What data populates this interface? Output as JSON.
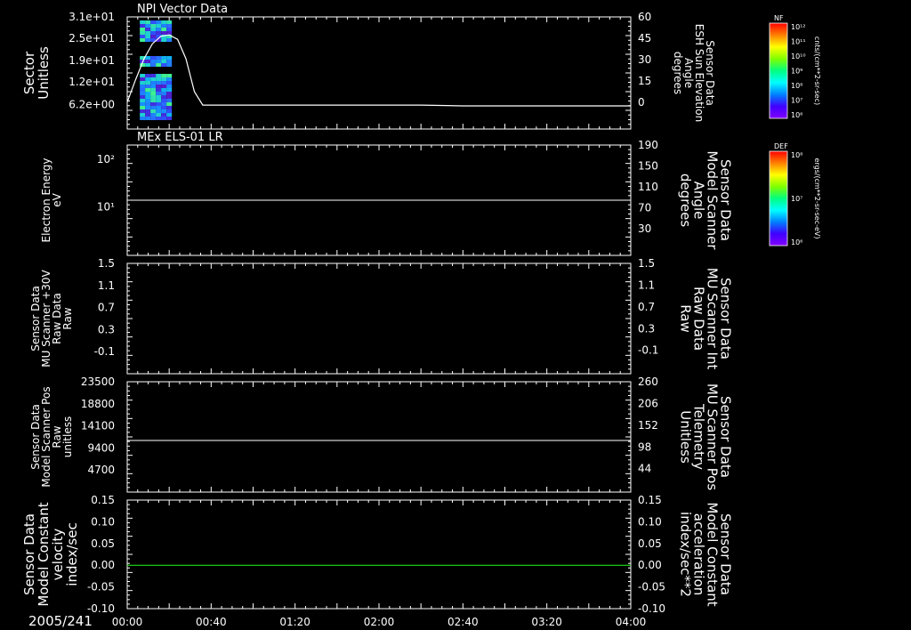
{
  "chart_data": [
    {
      "type": "heatmap",
      "title": "NPI Vector Data",
      "ylabel": "Sector\nUnitless",
      "y_scale": "log",
      "yticks": [
        "3.1e+01",
        "2.5e+01",
        "1.9e+01",
        "1.2e+01",
        "6.2e+00"
      ],
      "y2label": "Sensor Data\nESH Sun Elevation\nAngle\ndegrees",
      "y2ticks": [
        "60",
        "45",
        "30",
        "15",
        "0"
      ],
      "y2lim": [
        -15,
        60
      ],
      "line_series": {
        "x_minutes": [
          0,
          4,
          8,
          12,
          16,
          20,
          24,
          28,
          32,
          36,
          40,
          44,
          48,
          52,
          60,
          80,
          100,
          120,
          140,
          160,
          180,
          200,
          220,
          240
        ],
        "y": [
          3,
          18,
          32,
          42,
          47,
          48,
          45,
          32,
          10,
          1,
          1,
          1,
          1,
          1,
          1,
          1,
          1,
          1,
          1,
          0.5,
          0.5,
          0.5,
          0.5,
          0.5
        ]
      },
      "colorbar": {
        "label": "NF",
        "units": "cnts/(cm**2-sr-sec)",
        "ticks": [
          "10¹²",
          "10¹¹",
          "10¹⁰",
          "10⁹",
          "10⁸",
          "10⁷",
          "10⁶"
        ]
      }
    },
    {
      "type": "line",
      "title": "MEx ELS-01 LR",
      "ylabel": "Electron Energy\neV",
      "y_scale": "log",
      "yticks": [
        "10²",
        "10¹"
      ],
      "y2label": "Sensor Data\nModel Scanner\nAngle\ndegrees",
      "y2ticks": [
        "190",
        "150",
        "110",
        "70",
        "30"
      ],
      "y2lim": [
        0,
        190
      ],
      "series": [
        {
          "x_minutes": [
            0,
            240
          ],
          "y": [
            100,
            100
          ]
        }
      ],
      "colorbar": {
        "label": "DEF",
        "units": "ergs/(cm**2-sr-sec-eV)",
        "ticks": [
          "10⁸",
          "10⁷",
          "10⁶"
        ]
      }
    },
    {
      "type": "line",
      "ylabel": "Sensor Data\nMU Scanner +30V\nRaw Data\nRaw",
      "yticks": [
        "1.5",
        "1.1",
        "0.7",
        "0.3",
        "-0.1"
      ],
      "ylim": [
        -0.4,
        1.5
      ],
      "y2label": "Sensor Data\nMU Scanner Int\nRaw Data\nRaw",
      "y2ticks": [
        "1.5",
        "1.1",
        "0.7",
        "0.3",
        "-0.1"
      ],
      "y2color": "#ff2020"
    },
    {
      "type": "line",
      "ylabel": "Sensor Data\nModel Scanner Pos\nRaw\nunitless",
      "yticks": [
        "23500",
        "18800",
        "14100",
        "9400",
        "4700"
      ],
      "ylim": [
        0,
        23500
      ],
      "y2label": "Sensor Data\nMU Scanner Pos\nTelemetry\nUnitless",
      "y2ticks": [
        "260",
        "206",
        "152",
        "98",
        "44"
      ],
      "y2lim": [
        0,
        260
      ],
      "y2color": "#ff2020",
      "series": [
        {
          "x_minutes": [
            0,
            240
          ],
          "y": [
            11000,
            11000
          ]
        }
      ]
    },
    {
      "type": "line",
      "ylabel": "Sensor Data\nModel Constant\nvelocity\nindex/sec",
      "yticks": [
        "0.15",
        "0.10",
        "0.05",
        "0.00",
        "-0.05",
        "-0.10"
      ],
      "ylim": [
        -0.1,
        0.15
      ],
      "y2label": "Sensor Data\nModel Constant\nacceleration\nindex/sec**2",
      "y2ticks": [
        "0.15",
        "0.10",
        "0.05",
        "0.00",
        "-0.05",
        "-0.10"
      ],
      "y2color": "#20ff20",
      "series": [
        {
          "x_minutes": [
            0,
            240
          ],
          "y": [
            0,
            0
          ],
          "color": "#20ff20"
        }
      ]
    }
  ],
  "x_axis": {
    "date_label": "2005/241",
    "ticks": [
      "00:00",
      "00:40",
      "01:20",
      "02:00",
      "02:40",
      "03:20",
      "04:00"
    ],
    "xlim_minutes": [
      0,
      240
    ]
  },
  "colors": {
    "background": "#000000",
    "axes": "#ffffff",
    "red_label": "#ff2020",
    "green_label": "#20ff20"
  }
}
